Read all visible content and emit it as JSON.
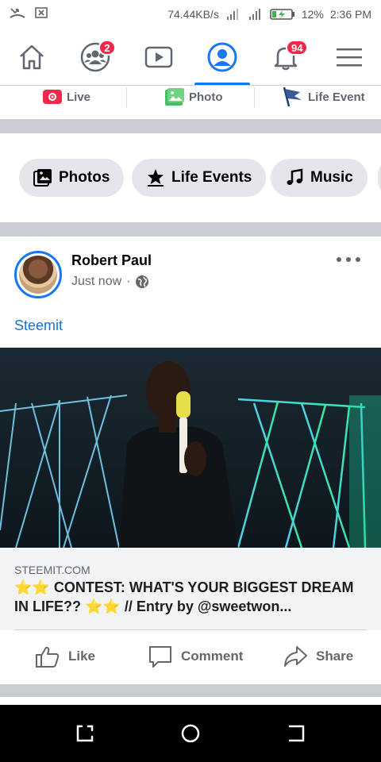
{
  "status_bar": {
    "speed": "74.44KB/s",
    "battery": "12%",
    "time": "2:36 PM",
    "icons": [
      "missed-call-icon",
      "no-sim-icon",
      "signal-icon",
      "battery-charging-icon"
    ]
  },
  "nav": {
    "items": [
      {
        "name": "home-icon",
        "badge": ""
      },
      {
        "name": "friends-icon",
        "badge": "2"
      },
      {
        "name": "watch-icon",
        "badge": ""
      },
      {
        "name": "profile-icon",
        "badge": "",
        "active": true
      },
      {
        "name": "notifications-icon",
        "badge": "94"
      },
      {
        "name": "menu-icon",
        "badge": ""
      }
    ],
    "friends_badge": "2",
    "notifications_badge": "94",
    "accent": "#1877f2"
  },
  "compose": {
    "live": "Live",
    "photo": "Photo",
    "life_event": "Life Event"
  },
  "chips": {
    "photos": "Photos",
    "life_events": "Life Events",
    "music": "Music"
  },
  "post": {
    "author": "Robert Paul",
    "time": "Just now",
    "separator": "·",
    "text": "Steemit",
    "link_domain": "STEEMIT.COM",
    "link_title": "⭐⭐ CONTEST: WHAT'S YOUR BIGGEST DREAM IN LIFE?? ⭐⭐ // Entry by @sweetwon...",
    "actions": {
      "like": "Like",
      "comment": "Comment",
      "share": "Share"
    }
  },
  "colors": {
    "link_blue": "#1a73c9",
    "badge_red": "#f02849",
    "gap_gray": "#c9ccd1"
  }
}
